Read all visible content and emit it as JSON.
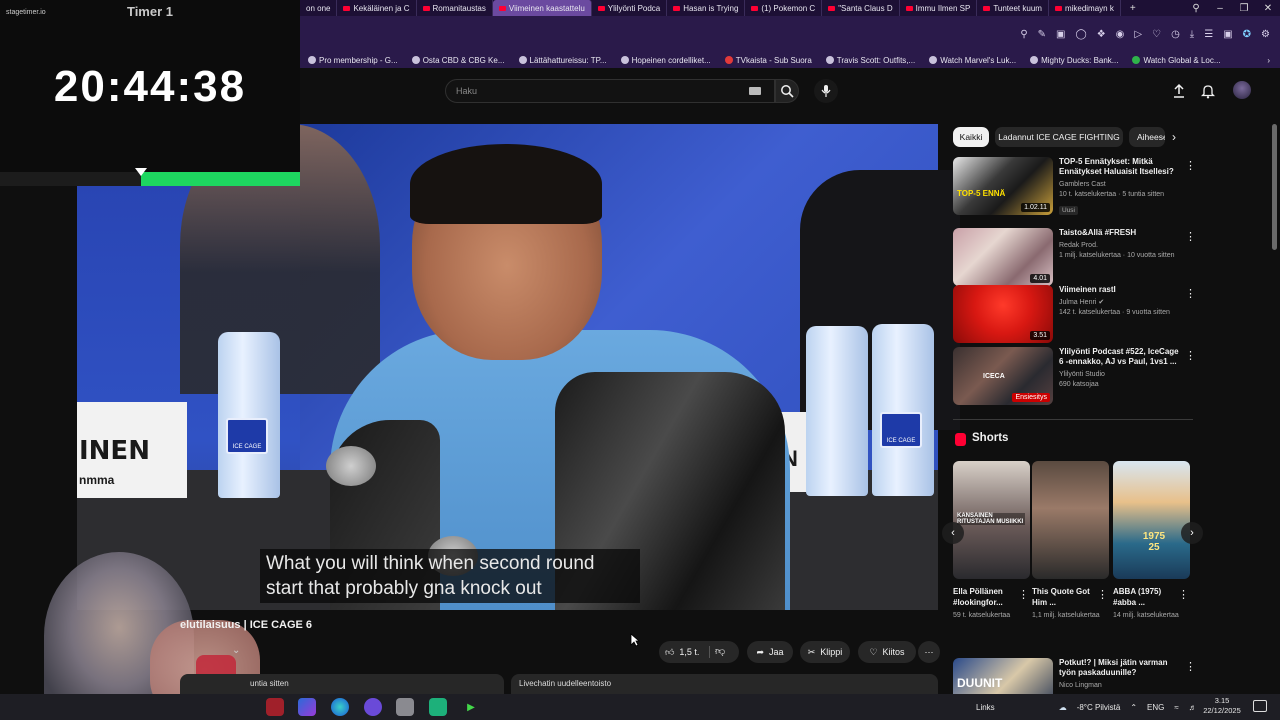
{
  "browser": {
    "tabs": [
      {
        "label": "on one",
        "active": false
      },
      {
        "label": "Kekäläinen ja C",
        "active": false
      },
      {
        "label": "Romanitaustas",
        "active": false
      },
      {
        "label": "Viimeinen kaastattelu",
        "active": true
      },
      {
        "label": "Ylilyönti Podca",
        "active": false
      },
      {
        "label": "Hasan is Trying",
        "active": false
      },
      {
        "label": "(1) Pokemon C",
        "active": false
      },
      {
        "label": "\"Santa Claus D",
        "active": false
      },
      {
        "label": "Immu Ilmen SP",
        "active": false
      },
      {
        "label": "Tunteet kuum",
        "active": false
      },
      {
        "label": "mikedimayn k",
        "active": false
      }
    ],
    "new_tab": "+",
    "bookmarks": [
      "Pro membership - G...",
      "Osta CBD & CBG Ke...",
      "Lättähattureissu: TP...",
      "Hopeinen cordelliket...",
      "TVkaista - Sub Suora",
      "Travis Scott: Outfits,...",
      "Watch Marvel's Luk...",
      "Mighty Ducks: Bank...",
      "Watch Global & Loc..."
    ]
  },
  "timer": {
    "brand": "stagetimer.io",
    "title": "Timer 1",
    "time": "20:44:38",
    "progress_remaining": 0.53
  },
  "search": {
    "placeholder": "Haku"
  },
  "video": {
    "placard_left_big": "INEN",
    "placard_left_small": "nmma",
    "placard_right": "N",
    "bottle_brand": "ICE CAGE",
    "subtitle_line1": "What you will think when second round",
    "subtitle_line2": "start that probably gna knock out",
    "title": "elutilaisuus | ICE CAGE 6"
  },
  "actions": {
    "likes": "1,5 t.",
    "share": "Jaa",
    "clip": "Klippi",
    "thanks": "Kiitos",
    "more": "⋯"
  },
  "below_video": {
    "desc_left": "untia sitten",
    "desc_right": "Livechatin uudelleentoisto"
  },
  "sidebar": {
    "chips": [
      "Kaikki",
      "Ladannut ICE CAGE FIGHTING",
      "Aiheeseen liittyvät"
    ],
    "recommendations": [
      {
        "title": "TOP-5 Ennätykset: Mitkä Ennätykset Haluaisit Itsellesi?",
        "channel": "Gamblers Cast",
        "meta": "10 t. katselukertaa · 5 tuntia sitten",
        "badge": "Uusi",
        "duration": "1.02.11",
        "thumb_text": "TOP-5 ENNÄ"
      },
      {
        "title": "Taisto&Allä #FRESH",
        "channel": "Redak Prod.",
        "meta": "1 milj. katselukertaa · 10 vuotta sitten",
        "badge": "",
        "duration": "4.01",
        "thumb_text": ""
      },
      {
        "title": "Viimeinen rastI",
        "channel": "Julma Henri",
        "meta": "142 t. katselukertaa · 9 vuotta sitten",
        "badge": "",
        "duration": "3.51",
        "thumb_text": ""
      },
      {
        "title": "Ylilyönti Podcast #522, IceCage 6 -ennakko, AJ vs Paul, 1vs1 ...",
        "channel": "Ylilyönti Studio",
        "meta": "690 katsojaa",
        "badge": "",
        "duration": "Ensiesitys",
        "thumb_text": "ICECA"
      }
    ],
    "shorts_title": "Shorts",
    "shorts": [
      {
        "title": "Ella Pöllänen #lookingfor...",
        "views": "59 t. katselukertaa",
        "overlay": "KANSAINEN RITUSTAJAN MUSIIKKI"
      },
      {
        "title": "This Quote Got Him ...",
        "views": "1,1 milj. katselukertaa",
        "overlay": ""
      },
      {
        "title": "ABBA (1975) #abba ...",
        "views": "14 milj. katselukertaa",
        "overlay": "1975 25"
      }
    ],
    "last_rec": {
      "title": "Potkut!? | Miksi jätin varman työn paskaduunille?",
      "channel": "Nico Lingman",
      "thumb_text": "DUUNIT"
    }
  },
  "taskbar": {
    "links_label": "Links",
    "weather": "-8°C Pilvistä",
    "lang": "ENG",
    "time": "3.15",
    "date": "22/12/2025"
  },
  "colors": {
    "yt_red": "#ff0033",
    "timer_green": "#1ed760",
    "browser_purple": "#2a1a4a"
  }
}
